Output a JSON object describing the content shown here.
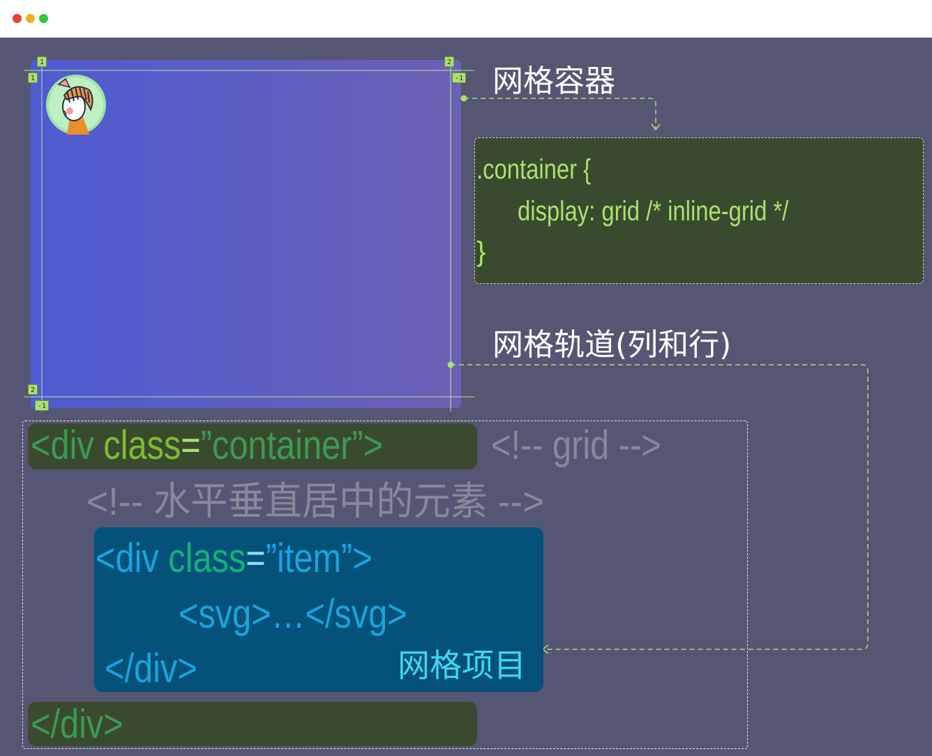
{
  "window": {
    "controls": [
      "close",
      "minimize",
      "maximize"
    ]
  },
  "colors": {
    "canvas": "#555674",
    "accent": "#a9e26f",
    "code_bg": "#3a4a2e",
    "item_bg": "#04527a"
  },
  "grid_preview": {
    "line_markers": {
      "col_start": "1",
      "col_end": "2",
      "row_start": "1",
      "row_end_neg": "-1",
      "row_end": "2",
      "col_end_neg": "-1"
    },
    "avatar_icon": "avatar-illustration"
  },
  "labels": {
    "grid_container": "网格容器",
    "grid_tracks": "网格轨道(列和行)",
    "grid_item": "网格项目"
  },
  "css_code": {
    "line1": ".container {",
    "line2": "display:  grid   /*  inline-grid */",
    "line3": "}"
  },
  "html_code": {
    "open_div_tag": "<div ",
    "open_div_attr": "class",
    "open_div_eq": "=",
    "open_div_val": "”container”>",
    "open_div_comment": "<!--  grid -->",
    "center_comment": "<!-- 水平垂直居中的元素 -->",
    "item_tag": "<div ",
    "item_attr": "class",
    "item_eq": "=",
    "item_val": "”item”>",
    "svg_line": "<svg>…</svg>",
    "item_close": "</div>",
    "close_div": "</div>"
  }
}
